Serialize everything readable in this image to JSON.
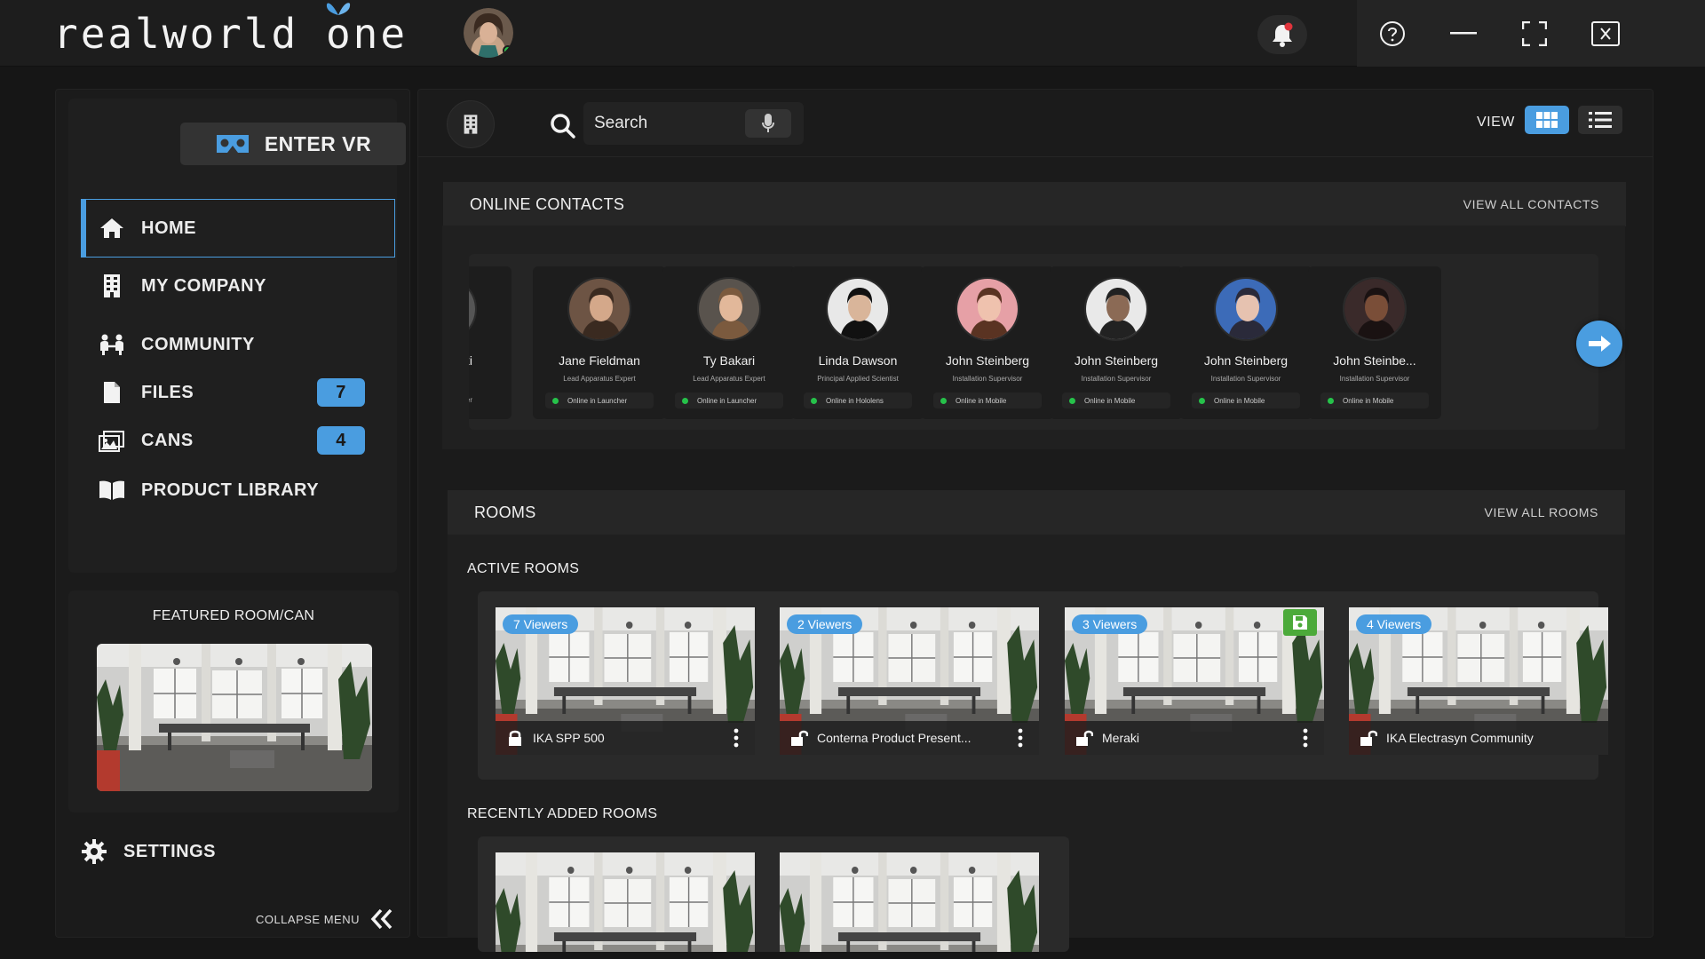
{
  "app": {
    "logo_text_a": "realworld ",
    "logo_text_b": "one",
    "accent_color": "#4a9de0",
    "online_color": "#26c24a"
  },
  "topbar": {
    "notification_icon": "bell-icon",
    "help_icon": "help-icon",
    "minimize_icon": "minimize-icon",
    "fullscreen_icon": "fullscreen-icon",
    "close_icon": "close-icon"
  },
  "sidebar": {
    "enter_vr_label": "ENTER VR",
    "items": [
      {
        "label": "HOME",
        "icon": "home-icon",
        "active": true
      },
      {
        "label": "MY COMPANY",
        "icon": "building-icon"
      },
      {
        "label": "COMMUNITY",
        "icon": "community-icon"
      },
      {
        "label": "FILES",
        "icon": "file-icon",
        "badge": "7"
      },
      {
        "label": "CANS",
        "icon": "cans-icon",
        "badge": "4"
      },
      {
        "label": "PRODUCT LIBRARY",
        "icon": "book-icon"
      }
    ],
    "featured_title": "FEATURED ROOM/CAN",
    "settings_label": "SETTINGS",
    "collapse_label": "COLLAPSE MENU"
  },
  "toolbar": {
    "search_placeholder": "Search",
    "view_label": "VIEW",
    "view_mode": "grid"
  },
  "contacts": {
    "title": "ONLINE CONTACTS",
    "view_all": "VIEW ALL CONTACTS",
    "partial_first": {
      "name": "...cki",
      "role": "...alyst",
      "status": "...uncher"
    },
    "items": [
      {
        "name": "Jane Fieldman",
        "role": "Lead Apparatus Expert",
        "status": "Online in Launcher"
      },
      {
        "name": "Ty Bakari",
        "role": "Lead Apparatus Expert",
        "status": "Online in Launcher"
      },
      {
        "name": "Linda Dawson",
        "role": "Principal Applied Scientist",
        "status": "Online in Hololens"
      },
      {
        "name": "John Steinberg",
        "role": "Installation Supervisor",
        "status": "Online in Mobile"
      },
      {
        "name": "John Steinberg",
        "role": "Installation Supervisor",
        "status": "Online in Mobile"
      },
      {
        "name": "John Steinberg",
        "role": "Installation Supervisor",
        "status": "Online in Mobile"
      },
      {
        "name": "John Steinbe...",
        "role": "Installation Supervisor",
        "status": "Online in Mobile"
      }
    ]
  },
  "rooms": {
    "title": "ROOMS",
    "view_all": "VIEW ALL ROOMS",
    "active_title": "ACTIVE ROOMS",
    "active": [
      {
        "viewers": "7 Viewers",
        "name": "IKA SPP 500",
        "locked": true
      },
      {
        "viewers": "2 Viewers",
        "name": "Conterna Product Present...",
        "locked": false
      },
      {
        "viewers": "3 Viewers",
        "name": "Meraki",
        "locked": false,
        "saved": true
      },
      {
        "viewers": "4 Viewers",
        "name": "IKA Electrasyn Community",
        "locked": false
      }
    ],
    "recent_title": "RECENTLY ADDED ROOMS",
    "recent_count": 2
  }
}
